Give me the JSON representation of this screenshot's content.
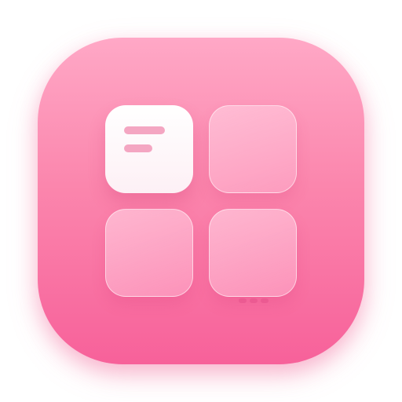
{
  "icon": {
    "colors": {
      "gradient_top": "#ffa8c6",
      "gradient_mid": "#fb86ad",
      "gradient_bottom": "#f7619a",
      "solid_tile": "#ffffff",
      "text_line": "#f4a6c2"
    },
    "tiles": [
      {
        "name": "widget-tile-top-left",
        "style": "solid",
        "content": "text-lines-icon"
      },
      {
        "name": "widget-tile-top-right",
        "style": "glass"
      },
      {
        "name": "widget-tile-bottom-left",
        "style": "glass"
      },
      {
        "name": "widget-tile-bottom-right",
        "style": "glass"
      }
    ]
  }
}
